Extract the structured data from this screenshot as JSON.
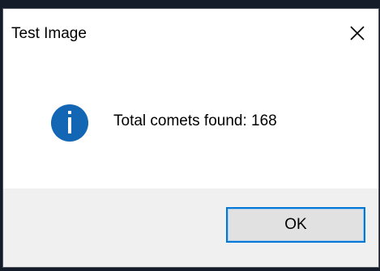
{
  "window": {
    "title": "Test Image",
    "close_icon": "close-icon"
  },
  "message": {
    "icon": "info-icon",
    "text": "Total comets found: 168"
  },
  "buttons": {
    "ok_label": "OK"
  },
  "colors": {
    "accent": "#0078d7",
    "info_icon": "#1366b3",
    "footer_background": "#f0f0f0",
    "button_background": "#e1e1e1"
  }
}
